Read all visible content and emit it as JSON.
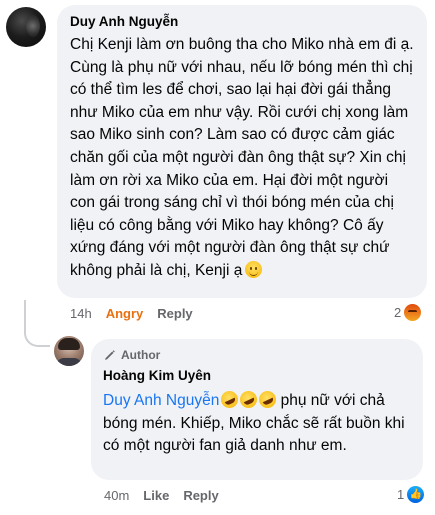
{
  "comment": {
    "author": "Duy Anh Nguyễn",
    "text": "Chị Kenji làm ơn buông tha cho Miko nhà em đi ạ. Cùng là phụ nữ với nhau, nếu lỡ bóng mén thì chị có thể tìm les để chơi, sao lại hại đời gái thẳng như Miko của em như vậy. Rồi cưới chị xong làm sao Miko sinh con? Làm sao có được cảm giác chăn gối của một người đàn ông thật sự? Xin chị làm ơn rời xa Miko của em. Hại đời một người con gái trong sáng chỉ vì thói bóng mén của chị liệu có công bằng với Miko hay không? Cô ấy xứng đáng với một người đàn ông thật sự chứ không phải là chị, Kenji ạ",
    "emoji_icon": "slightly-smiling-face-icon",
    "time": "14h",
    "reaction_label": "Angry",
    "reply_label": "Reply",
    "reaction_count": "2",
    "reaction_icon": "angry-reaction-icon"
  },
  "reply": {
    "badge": "Author",
    "badge_icon": "pen-icon",
    "author": "Hoàng Kim Uyên",
    "mention": "Duy Anh Nguyễn",
    "emoji_icon": "rolling-on-floor-laughing-icon",
    "text": " phụ nữ với chả bóng mén. Khiếp, Miko chắc sẽ rất buồn khi có một người fan giả danh như em.",
    "time": "40m",
    "like_label": "Like",
    "reply_label": "Reply",
    "reaction_count": "1",
    "reaction_icon": "like-reaction-icon"
  },
  "colors": {
    "bubble": "#f0f2f5",
    "mention": "#1876f2",
    "angry": "#e9710f",
    "meta": "#65676b"
  }
}
